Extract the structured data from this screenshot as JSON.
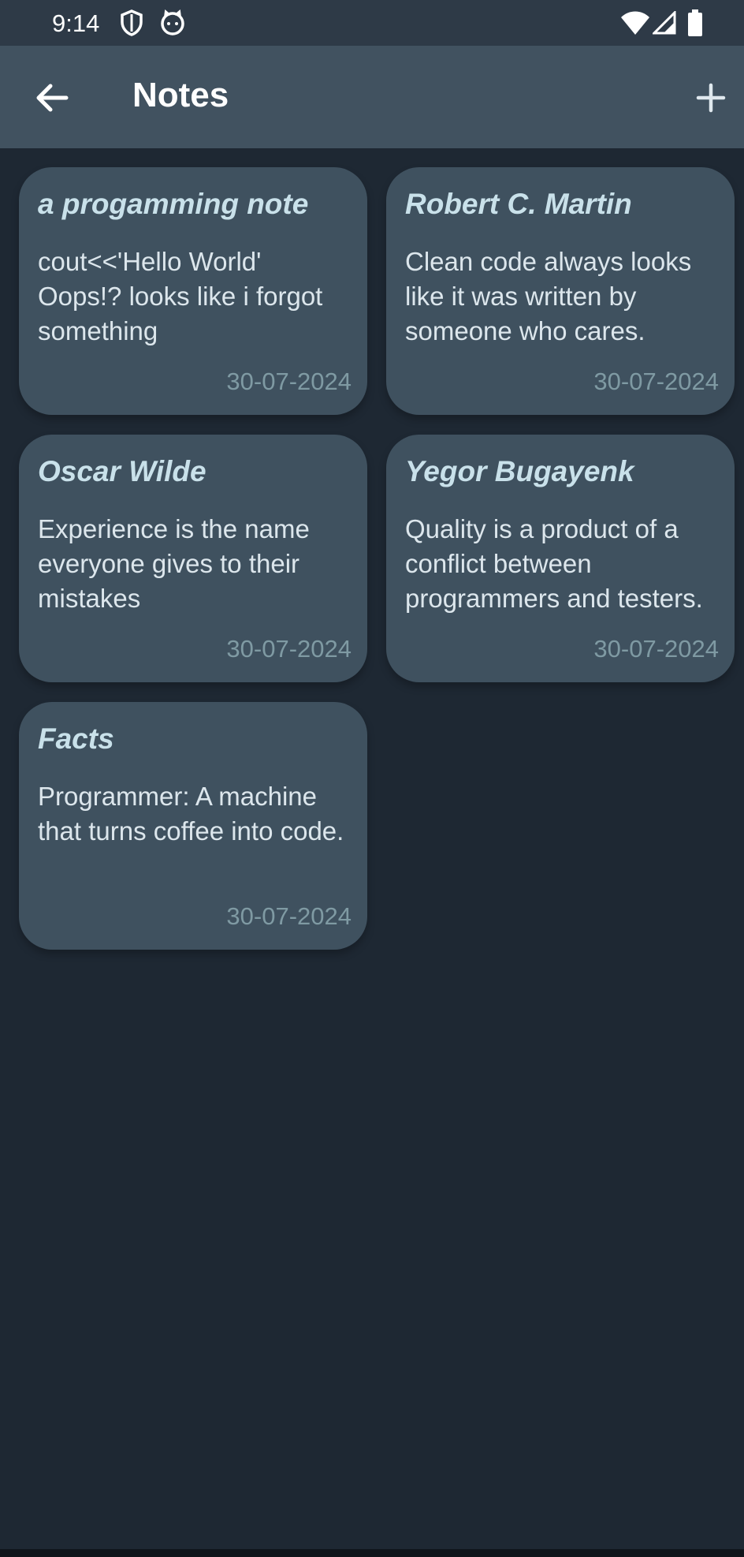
{
  "status": {
    "time": "9:14"
  },
  "appbar": {
    "title": "Notes"
  },
  "notes": [
    {
      "title": "a progamming note",
      "body": "cout<<'Hello World'\nOops!? looks like i forgot something",
      "date": "30-07-2024"
    },
    {
      "title": "Robert C. Martin",
      "body": "Clean code always looks like it was written by someone who cares.",
      "date": "30-07-2024"
    },
    {
      "title": "Oscar Wilde",
      "body": "Experience is the name everyone gives to their mistakes",
      "date": "30-07-2024"
    },
    {
      "title": "Yegor Bugayenk",
      "body": "Quality is a product of a conflict between programmers and testers.",
      "date": "30-07-2024"
    },
    {
      "title": "Facts",
      "body": "Programmer: A machine that turns coffee into code.",
      "date": "30-07-2024"
    }
  ],
  "icons": {
    "back": "arrow-left-icon",
    "add": "plus-icon",
    "shield": "shield-icon",
    "cat": "cat-icon",
    "wifi": "wifi-icon",
    "signal": "signal-icon",
    "battery": "battery-icon"
  },
  "colors": {
    "background": "#1e2833",
    "appbar": "#415260",
    "card": "#3f515f",
    "title": "#c9e1ea",
    "date": "#7f9aa3"
  }
}
